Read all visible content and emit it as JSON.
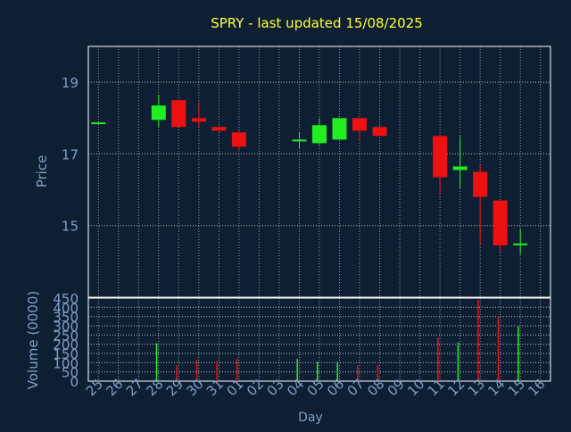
{
  "colors": {
    "background": "#0f1f33",
    "frame": "#ffffff",
    "grid": "#ffffff",
    "title": "#ffff33",
    "axis_text": "#7f9fc4",
    "up": "#22ee22",
    "down": "#ee1111"
  },
  "chart_data": [
    {
      "type": "candlestick",
      "title": "SPRY - last updated 15/08/2025",
      "ylabel": "Price",
      "ylim": [
        13,
        20
      ],
      "yticks": [
        15,
        17,
        19
      ],
      "grid": true,
      "x": [
        "25",
        "26",
        "27",
        "28",
        "29",
        "30",
        "31",
        "01",
        "02",
        "03",
        "04",
        "05",
        "06",
        "07",
        "08",
        "09",
        "10",
        "11",
        "12",
        "13",
        "14",
        "15",
        "16"
      ],
      "candles": [
        {
          "day": "25",
          "open": 17.88,
          "close": 17.88,
          "high": 17.88,
          "low": 17.88
        },
        {
          "day": "28",
          "open": 17.95,
          "close": 18.35,
          "high": 18.65,
          "low": 17.75
        },
        {
          "day": "29",
          "open": 18.5,
          "close": 17.75,
          "high": 18.5,
          "low": 17.75
        },
        {
          "day": "30",
          "open": 18.0,
          "close": 17.9,
          "high": 18.45,
          "low": 17.75
        },
        {
          "day": "31",
          "open": 17.75,
          "close": 17.65,
          "high": 17.75,
          "low": 17.6
        },
        {
          "day": "01",
          "open": 17.6,
          "close": 17.2,
          "high": 17.65,
          "low": 17.05
        },
        {
          "day": "04",
          "open": 17.35,
          "close": 17.4,
          "high": 17.6,
          "low": 17.15
        },
        {
          "day": "05",
          "open": 17.3,
          "close": 17.8,
          "high": 18.0,
          "low": 17.25
        },
        {
          "day": "06",
          "open": 17.4,
          "close": 18.0,
          "high": 18.0,
          "low": 17.4
        },
        {
          "day": "07",
          "open": 18.0,
          "close": 17.65,
          "high": 18.0,
          "low": 17.35
        },
        {
          "day": "08",
          "open": 17.75,
          "close": 17.5,
          "high": 17.85,
          "low": 17.5
        },
        {
          "day": "11",
          "open": 17.5,
          "close": 16.35,
          "high": 17.55,
          "low": 15.9
        },
        {
          "day": "12",
          "open": 16.55,
          "close": 16.65,
          "high": 17.5,
          "low": 16.05
        },
        {
          "day": "13",
          "open": 16.5,
          "close": 15.8,
          "high": 16.7,
          "low": 14.45
        },
        {
          "day": "14",
          "open": 15.7,
          "close": 14.45,
          "high": 15.7,
          "low": 14.25
        },
        {
          "day": "15",
          "open": 14.45,
          "close": 14.5,
          "high": 14.9,
          "low": 14.2
        }
      ]
    },
    {
      "type": "bar",
      "ylabel": "Volume (0000)",
      "xlabel": "Day",
      "ylim": [
        0,
        450
      ],
      "yticks": [
        0,
        50,
        100,
        150,
        200,
        250,
        300,
        350,
        400,
        450
      ],
      "grid": true,
      "x": [
        "25",
        "26",
        "27",
        "28",
        "29",
        "30",
        "31",
        "01",
        "02",
        "03",
        "04",
        "05",
        "06",
        "07",
        "08",
        "09",
        "10",
        "11",
        "12",
        "13",
        "14",
        "15",
        "16"
      ],
      "bars": [
        {
          "day": "28",
          "value": 205,
          "direction": "up"
        },
        {
          "day": "29",
          "value": 85,
          "direction": "down"
        },
        {
          "day": "30",
          "value": 115,
          "direction": "down"
        },
        {
          "day": "31",
          "value": 110,
          "direction": "down"
        },
        {
          "day": "01",
          "value": 120,
          "direction": "down"
        },
        {
          "day": "04",
          "value": 120,
          "direction": "up"
        },
        {
          "day": "05",
          "value": 105,
          "direction": "up"
        },
        {
          "day": "06",
          "value": 105,
          "direction": "up"
        },
        {
          "day": "07",
          "value": 85,
          "direction": "down"
        },
        {
          "day": "08",
          "value": 85,
          "direction": "down"
        },
        {
          "day": "11",
          "value": 235,
          "direction": "down"
        },
        {
          "day": "12",
          "value": 210,
          "direction": "up"
        },
        {
          "day": "13",
          "value": 440,
          "direction": "down"
        },
        {
          "day": "14",
          "value": 345,
          "direction": "down"
        },
        {
          "day": "15",
          "value": 295,
          "direction": "up"
        }
      ]
    }
  ]
}
